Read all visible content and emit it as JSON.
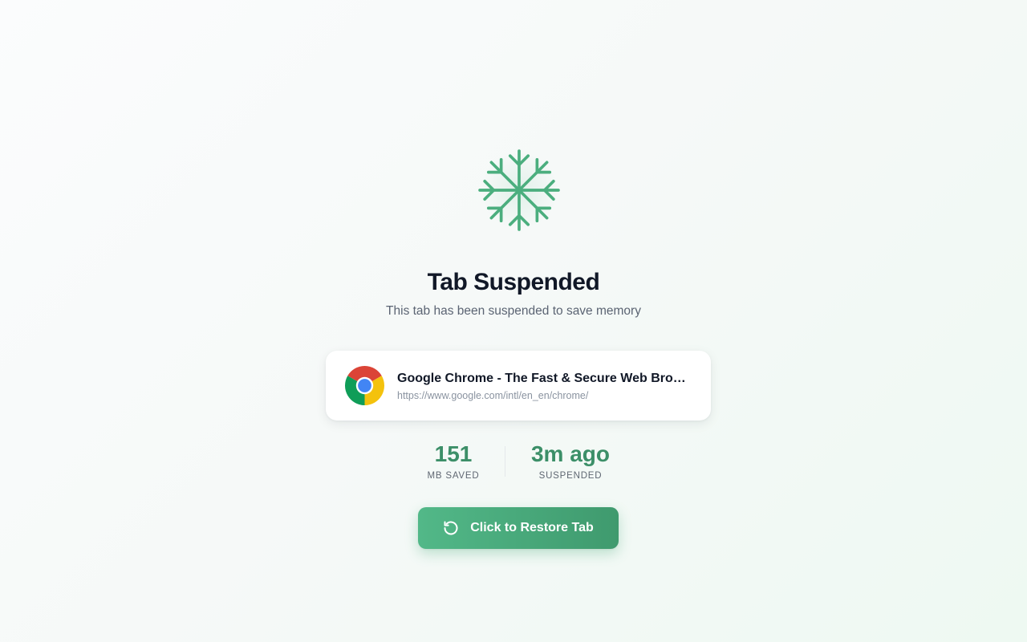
{
  "header": {
    "icon": "snowflake-icon",
    "title": "Tab Suspended",
    "subtitle": "This tab has been suspended to save memory"
  },
  "tab": {
    "favicon": "chrome-logo-icon",
    "title": "Google Chrome - The Fast & Secure Web Browser Built to be Yours",
    "url": "https://www.google.com/intl/en_en/chrome/"
  },
  "stats": {
    "memory_value": "151",
    "memory_label": "MB SAVED",
    "time_value": "3m ago",
    "time_label": "SUSPENDED"
  },
  "restore": {
    "icon": "restore-icon",
    "label": "Click to Restore Tab"
  },
  "colors": {
    "accent": "#4aa97a",
    "accent_dark": "#3c8f68",
    "title": "#111827",
    "muted": "#5b6473"
  }
}
